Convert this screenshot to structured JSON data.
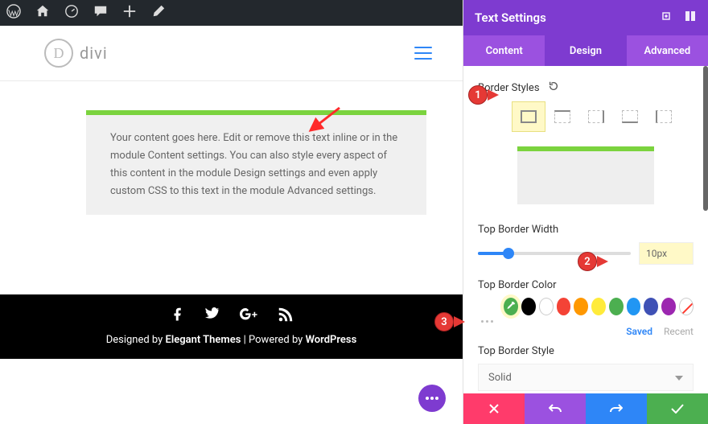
{
  "wp": {
    "pink": "*"
  },
  "logo": {
    "letter": "D",
    "name": "divi"
  },
  "content": {
    "body": "Your content goes here. Edit or remove this text inline or in the module Content settings. You can also style every aspect of this content in the module Design settings and even apply custom CSS to this text in the module Advanced settings."
  },
  "footer": {
    "credit_pre": "Designed by ",
    "credit_brand": "Elegant Themes",
    "credit_mid": " | Powered by ",
    "credit_wp": "WordPress"
  },
  "panel": {
    "title": "Text Settings",
    "tabs": {
      "content": "Content",
      "design": "Design",
      "advanced": "Advanced"
    },
    "border_styles_label": "Border Styles",
    "top_border_width_label": "Top Border Width",
    "top_border_width_value": "10px",
    "top_border_color_label": "Top Border Color",
    "saved": "Saved",
    "recent": "Recent",
    "top_border_style_label": "Top Border Style",
    "top_border_style_value": "Solid"
  },
  "swatches": [
    "#000000",
    "#ffffff",
    "#f44336",
    "#ff9800",
    "#ffeb3b",
    "#4caf50",
    "#2196f3",
    "#3f51b5",
    "#9c27b0"
  ],
  "callouts": {
    "c1": "1",
    "c2": "2",
    "c3": "3"
  }
}
